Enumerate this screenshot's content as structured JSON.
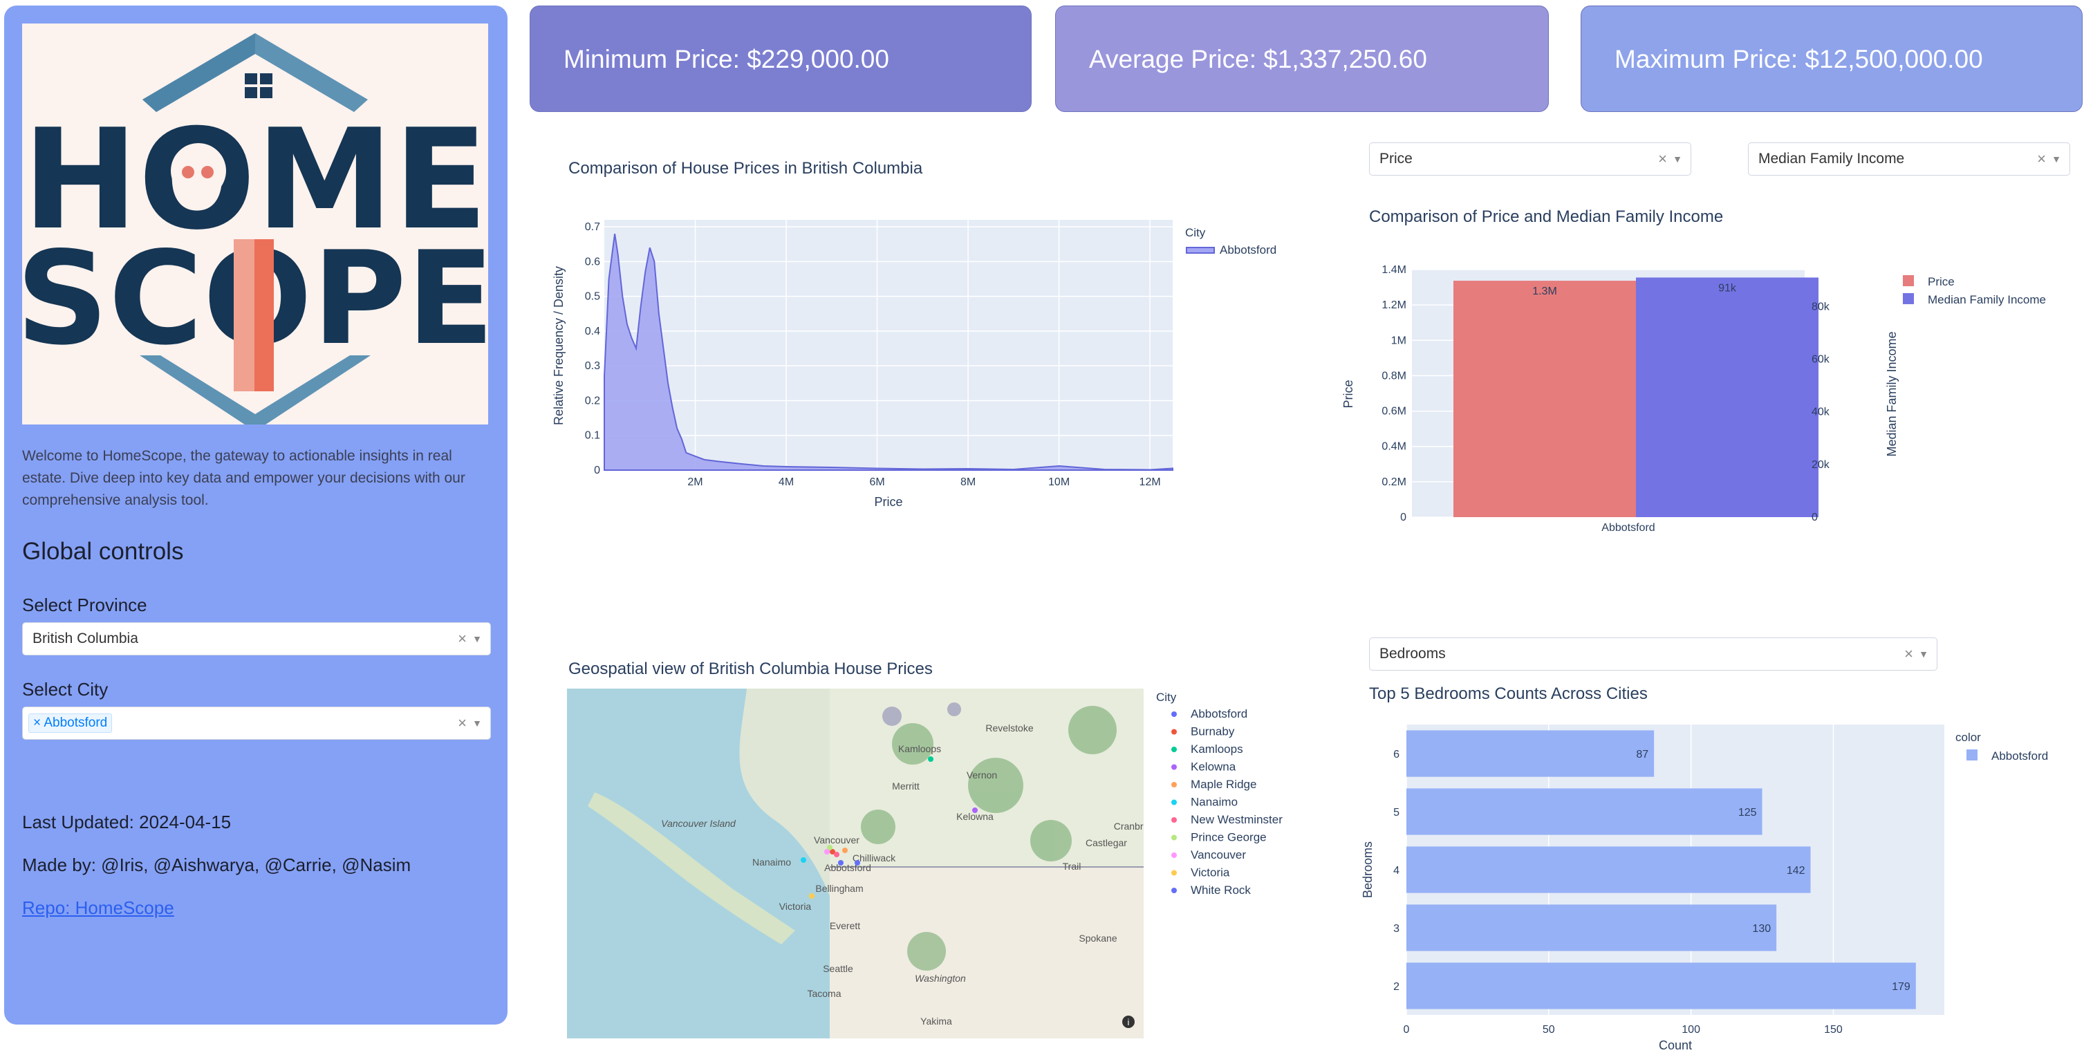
{
  "sidebar": {
    "logo_text_top": "HOME",
    "logo_text_bottom": "SCOPE",
    "welcome": "Welcome to HomeScope, the gateway to actionable insights in real estate. Dive deep into key data and empower your decisions with our comprehensive analysis tool.",
    "global_controls": "Global controls",
    "province_label": "Select Province",
    "province_value": "British Columbia",
    "city_label": "Select City",
    "city_chip": "Abbotsford",
    "last_updated": "Last Updated: 2024-04-15",
    "made_by": "Made by: @Iris, @Aishwarya, @Carrie, @Nasim",
    "repo_link": "Repo: HomeScope"
  },
  "cards": {
    "min": "Minimum Price: $229,000.00",
    "avg": "Average Price: $1,337,250.60",
    "max": "Maximum Price: $12,500,000.00",
    "colors": [
      "#7c7fd0",
      "#9a96dc",
      "#8ea3ea"
    ]
  },
  "density": {
    "title": "Comparison of House Prices in British Columbia",
    "legend_title": "City",
    "legend_item": "Abbotsford",
    "chart_data": {
      "type": "area",
      "xlabel": "Price",
      "ylabel": "Relative Frequency / Density",
      "x_ticks": [
        "2M",
        "4M",
        "6M",
        "8M",
        "10M",
        "12M"
      ],
      "y_ticks": [
        "0",
        "0.1",
        "0.2",
        "0.3",
        "0.4",
        "0.5",
        "0.6",
        "0.7"
      ],
      "xlim": [
        0,
        12500000
      ],
      "ylim": [
        0,
        0.72
      ],
      "series": [
        {
          "name": "Abbotsford",
          "x": [
            0,
            100000,
            229000,
            300000,
            400000,
            500000,
            600000,
            700000,
            800000,
            900000,
            1000000,
            1100000,
            1200000,
            1300000,
            1400000,
            1500000,
            1600000,
            1700000,
            1800000,
            2000000,
            2200000,
            2500000,
            3000000,
            3500000,
            4000000,
            5000000,
            6000000,
            7000000,
            8000000,
            9000000,
            10000000,
            11000000,
            12000000,
            12500000
          ],
          "y": [
            0.27,
            0.55,
            0.68,
            0.62,
            0.5,
            0.42,
            0.38,
            0.35,
            0.47,
            0.57,
            0.64,
            0.6,
            0.45,
            0.35,
            0.25,
            0.18,
            0.12,
            0.09,
            0.05,
            0.04,
            0.03,
            0.025,
            0.018,
            0.012,
            0.01,
            0.008,
            0.005,
            0.003,
            0.004,
            0.002,
            0.012,
            0.002,
            0.001,
            0.005
          ]
        }
      ],
      "color": "#6366d8"
    }
  },
  "dropdowns": {
    "metric1": "Price",
    "metric2": "Median Family Income",
    "bar_metric": "Bedrooms"
  },
  "compare": {
    "title": "Comparison of Price and Median Family Income",
    "chart_data": {
      "type": "bar",
      "categories": [
        "Abbotsford"
      ],
      "series": [
        {
          "name": "Price",
          "values": [
            1337250.6
          ],
          "label": "1.3M",
          "axis": "left",
          "color": "#e67c7c"
        },
        {
          "name": "Median Family Income",
          "values": [
            91000
          ],
          "label": "91k",
          "axis": "right",
          "color": "#7473e4"
        }
      ],
      "ylabel_left": "Price",
      "ylabel_right": "Median Family Income",
      "left_ticks": [
        "0",
        "0.2M",
        "0.4M",
        "0.6M",
        "0.8M",
        "1M",
        "1.2M",
        "1.4M"
      ],
      "right_ticks": [
        "0",
        "20k",
        "40k",
        "60k",
        "80k"
      ],
      "ylim_left": [
        0,
        1400000
      ],
      "ylim_right": [
        0,
        94000
      ]
    }
  },
  "map": {
    "title": "Geospatial view of British Columbia House Prices",
    "legend_title": "City",
    "cities": [
      {
        "name": "Abbotsford",
        "color": "#636efa"
      },
      {
        "name": "Burnaby",
        "color": "#ef553b"
      },
      {
        "name": "Kamloops",
        "color": "#00cc96"
      },
      {
        "name": "Kelowna",
        "color": "#ab63fa"
      },
      {
        "name": "Maple Ridge",
        "color": "#ffa15a"
      },
      {
        "name": "Nanaimo",
        "color": "#19d3f3"
      },
      {
        "name": "New Westminster",
        "color": "#ff6692"
      },
      {
        "name": "Prince George",
        "color": "#b6e880"
      },
      {
        "name": "Vancouver",
        "color": "#ff97ff"
      },
      {
        "name": "Victoria",
        "color": "#fecb52"
      },
      {
        "name": "White Rock",
        "color": "#636efa"
      }
    ],
    "labels": [
      "Revelstoke",
      "Kamloops",
      "Vernon",
      "Merritt",
      "Kelowna",
      "Vancouver Island",
      "Vancouver",
      "Chilliwack",
      "Nanaimo",
      "Abbotsford",
      "Castlegar",
      "Trail",
      "Cranbro",
      "Bellingham",
      "Victoria",
      "Everett",
      "Seattle",
      "Washington",
      "Spokane",
      "Tacoma",
      "Yakima"
    ]
  },
  "bars": {
    "title": "Top 5 Bedrooms Counts Across Cities",
    "legend_title": "color",
    "legend_item": "Abbotsford",
    "chart_data": {
      "type": "bar",
      "orientation": "horizontal",
      "categories": [
        "6",
        "5",
        "4",
        "3",
        "2"
      ],
      "values": [
        87,
        125,
        142,
        130,
        179
      ],
      "xlabel": "Count",
      "ylabel": "Bedrooms",
      "x_ticks": [
        "0",
        "50",
        "100",
        "150"
      ],
      "xlim": [
        0,
        189
      ],
      "color": "#97b1f6"
    }
  }
}
